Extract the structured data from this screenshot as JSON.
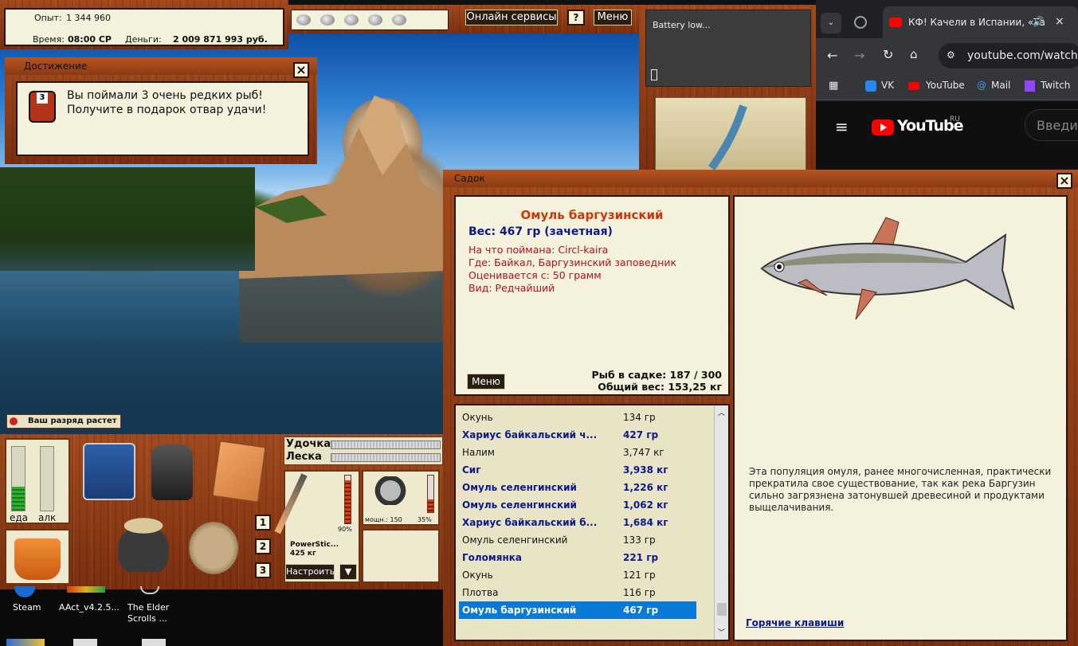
{
  "colors": {
    "wood": "#8a3a16",
    "cream": "#f4f1dc",
    "title_fish": "#c8380a",
    "bold_blue": "#0b1a8a",
    "desc_red": "#b0101a",
    "selected": "#0a7ad9"
  },
  "status": {
    "exp_label": "Опыт:",
    "exp_value": "1 344 960",
    "time_label": "Время:",
    "time_value": "08:00 СР",
    "money_label": "Деньги:",
    "money_value": "2 009 871 993 руб."
  },
  "top": {
    "online_label": "Онлайн сервисы",
    "help_label": "?",
    "menu_label": "Меню",
    "bait_icon_count": 5
  },
  "battery": {
    "text": "Battery low..."
  },
  "achievement": {
    "title": "Достижение",
    "badge_number": "3",
    "line1": "Вы поймали 3 очень редких рыб!",
    "line2": "Получите в подарок отвар удачи!"
  },
  "rank_notice": "Ваш разряд растет",
  "bottom": {
    "food_label": "еда",
    "alc_label": "алк",
    "food_level": 0.38,
    "alc_level": 0.0,
    "rod_label": "Удочка",
    "line_label": "Леска",
    "rod_name": "PowerStic...",
    "rod_weight": "425 кг",
    "rod_percent": "90%",
    "reel_power": "мощн.: 150",
    "reel_percent": "35%",
    "configure_label": "Настроить",
    "dropdown_label": "▼",
    "slots": [
      "1",
      "2",
      "3"
    ]
  },
  "desktop": {
    "icons": [
      {
        "label": "Steam"
      },
      {
        "label": "AAct_v4.2.5..."
      },
      {
        "label": "The Elder Scrolls ..."
      }
    ]
  },
  "browser": {
    "tab_title": "КФ! Качели в Испании, «Та",
    "url": "youtube.com/watch?v",
    "bookmarks": [
      {
        "label": "VK"
      },
      {
        "label": "YouTube"
      },
      {
        "label": "Mail"
      },
      {
        "label": "Twitch"
      }
    ],
    "logo_text": "YouTube",
    "logo_region": "RU",
    "search_placeholder": "Введит"
  },
  "sadok": {
    "title": "Садок",
    "fish_name": "Омуль баргузинский",
    "weight_line": "Вес: 467 гр (зачетная)",
    "caught_on": "На что поймана: Circl-kaira",
    "where": "Где: Байкал, Баргузинский заповедник",
    "valued_from": "Оценивается с: 50 грамм",
    "kind": "Вид: Редчайший",
    "menu_label": "Меню",
    "count_line": "Рыб в садке: 187 / 300",
    "total_line": "Общий вес: 153,25 кг",
    "description": "Эта популяция омуля, ранее многочисленная, практически прекратила свое существование, так как река Баргузин сильно загрязнена затонувшей древесиной и продуктами выщелачивания.",
    "hotkeys_label": "Горячие клавиши",
    "list": [
      {
        "name": "Окунь",
        "weight": "134 гр",
        "style": "normal"
      },
      {
        "name": "Хариус байкальский ч...",
        "weight": "427 гр",
        "style": "bold"
      },
      {
        "name": "Налим",
        "weight": "3,747 кг",
        "style": "normal"
      },
      {
        "name": "Сиг",
        "weight": "3,938 кг",
        "style": "bold"
      },
      {
        "name": "Омуль селенгинский",
        "weight": "1,226 кг",
        "style": "bold"
      },
      {
        "name": "Омуль селенгинский",
        "weight": "1,062 кг",
        "style": "bold"
      },
      {
        "name": "Хариус байкальский б...",
        "weight": "1,684 кг",
        "style": "bold"
      },
      {
        "name": "Омуль селенгинский",
        "weight": "133 гр",
        "style": "normal"
      },
      {
        "name": "Голомянка",
        "weight": "221 гр",
        "style": "bold"
      },
      {
        "name": "Окунь",
        "weight": "121 гр",
        "style": "normal"
      },
      {
        "name": "Плотва",
        "weight": "116 гр",
        "style": "normal"
      },
      {
        "name": "Омуль баргузинский",
        "weight": "467 гр",
        "style": "selected"
      }
    ]
  }
}
